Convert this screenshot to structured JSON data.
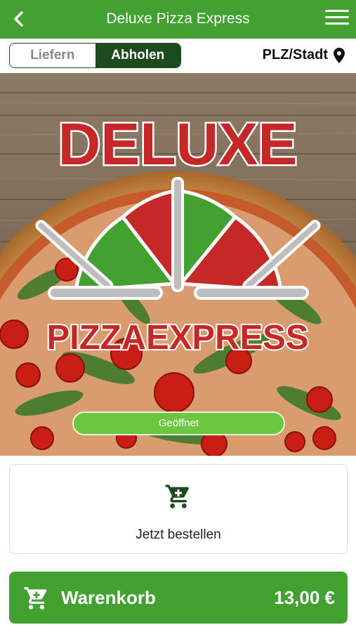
{
  "header": {
    "title": "Deluxe Pizza Express",
    "back_icon": "chevron-left-icon",
    "menu_icon": "hamburger-menu-icon"
  },
  "order_mode": {
    "deliver_label": "Liefern",
    "pickup_label": "Abholen",
    "selected": "Abholen"
  },
  "location": {
    "label": "PLZ/Stadt",
    "icon": "map-pin-icon"
  },
  "hero": {
    "logo_text_top": "DELUXE",
    "logo_text_bottom": "PIZZAEXPRESS",
    "status": "Geöffnet"
  },
  "order_card": {
    "icon": "cart-icon",
    "label": "Jetzt bestellen"
  },
  "basket": {
    "icon": "cart-icon",
    "label": "Warenkorb",
    "total": "13,00 €"
  },
  "colors": {
    "primary_green": "#43a132",
    "dark_green": "#1e4a1f",
    "status_green": "#6ac73f",
    "logo_red": "#c62828"
  }
}
